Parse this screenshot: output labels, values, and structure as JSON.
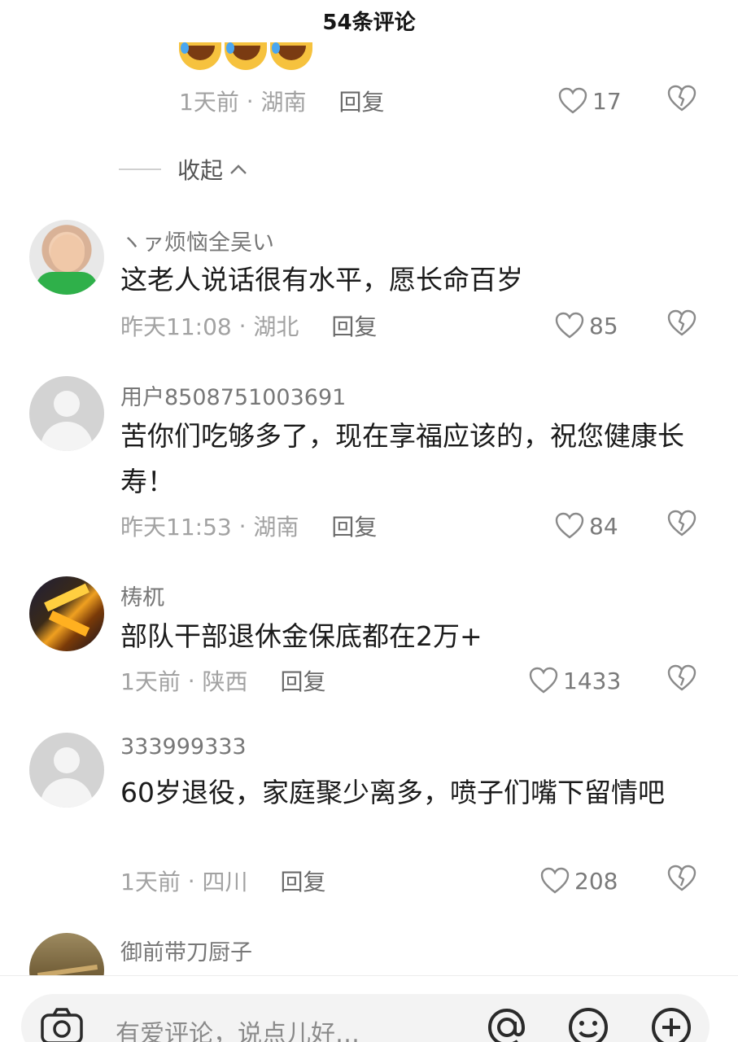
{
  "header": {
    "title": "54条评论"
  },
  "top_reply": {
    "emojis": [
      "laughing-crying",
      "laughing-crying",
      "laughing-crying"
    ],
    "time": "1天前",
    "location": "湖南",
    "reply_label": "回复",
    "likes": "17"
  },
  "collapse": {
    "label": "收起"
  },
  "comments": [
    {
      "username": "ヽァ烦恼全吴い",
      "content": "这老人说话很有水平，愿长命百岁",
      "time": "昨天11:08",
      "location": "湖北",
      "reply_label": "回复",
      "likes": "85"
    },
    {
      "username": "用户8508751003691",
      "content": "苦你们吃够多了，现在享福应该的，祝您健康长寿！",
      "time": "昨天11:53",
      "location": "湖南",
      "reply_label": "回复",
      "likes": "84"
    },
    {
      "username": "梼杌",
      "content": "部队干部退休金保底都在2万+",
      "time": "1天前",
      "location": "陕西",
      "reply_label": "回复",
      "likes": "1433"
    },
    {
      "username": "333999333",
      "content": "60岁退役，家庭聚少离多，喷子们嘴下留情吧",
      "time": "1天前",
      "location": "四川",
      "reply_label": "回复",
      "likes": "208"
    },
    {
      "username": "御前带刀厨子"
    }
  ],
  "input": {
    "placeholder": "有爱评论，说点儿好…"
  },
  "colors": {
    "meta": "#a2a2a2",
    "text": "#1b1b1b",
    "username": "#777777",
    "input_bg": "#f3f3f3"
  }
}
